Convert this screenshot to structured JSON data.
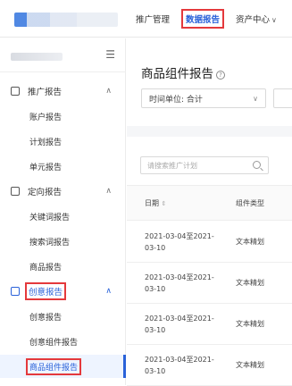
{
  "topnav": {
    "items": [
      {
        "label": "推广管理",
        "active": false
      },
      {
        "label": "数据报告",
        "active": true
      },
      {
        "label": "资产中心",
        "active": false
      }
    ]
  },
  "sidebar": {
    "collapse_icon": "menu-fold-icon",
    "groups": [
      {
        "label": "推广报告",
        "icon": "image-icon",
        "expanded": true,
        "items": [
          "账户报告",
          "计划报告",
          "单元报告"
        ]
      },
      {
        "label": "定向报告",
        "icon": "list-icon",
        "expanded": true,
        "items": [
          "关键词报告",
          "搜索词报告",
          "商品报告"
        ]
      },
      {
        "label": "创意报告",
        "icon": "doc-icon",
        "expanded": true,
        "active": true,
        "items": [
          "创意报告",
          "创意组件报告",
          "商品组件报告"
        ]
      }
    ],
    "selected_item": "商品组件报告"
  },
  "main": {
    "title": "商品组件报告",
    "time_unit_label": "时间单位: 合计",
    "search_placeholder": "请搜索推广计划",
    "table": {
      "headers": [
        "日期",
        "组件类型"
      ],
      "rows": [
        {
          "date": "2021-03-04至2021-03-10",
          "type": "文本精划"
        },
        {
          "date": "2021-03-04至2021-03-10",
          "type": "文本精划"
        },
        {
          "date": "2021-03-04至2021-03-10",
          "type": "文本精划"
        },
        {
          "date": "2021-03-04至2021-03-10",
          "type": "文本精划"
        }
      ]
    }
  },
  "colors": {
    "accent": "#2a62d9",
    "highlight_box": "#e4393c"
  }
}
